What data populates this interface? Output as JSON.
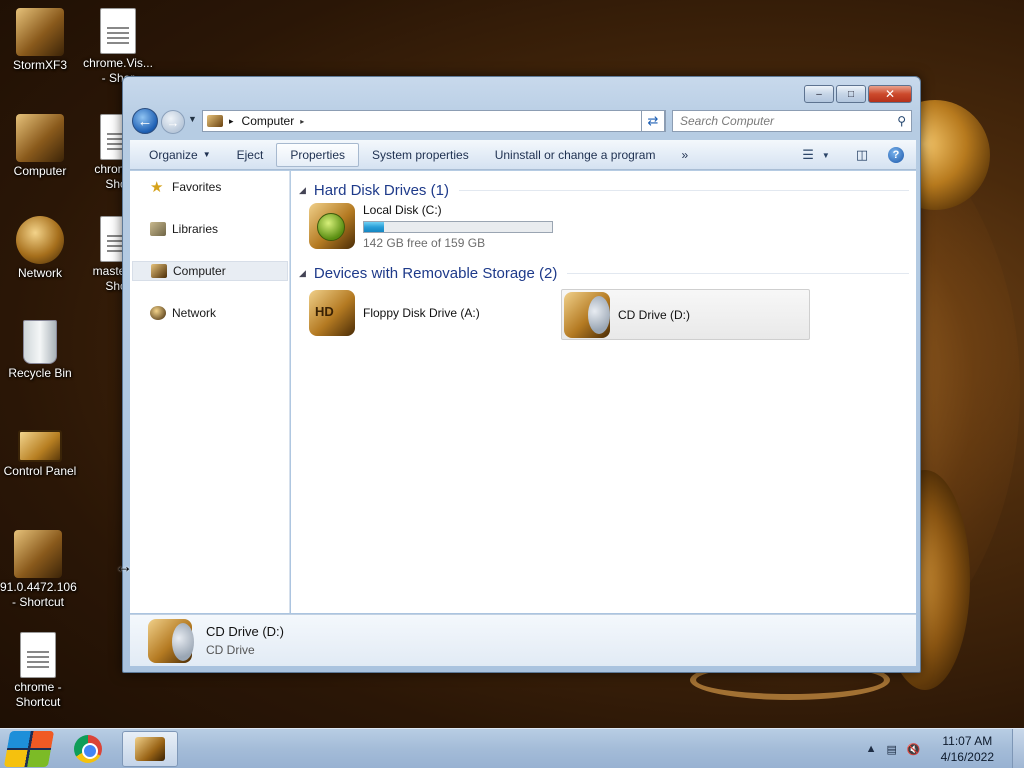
{
  "desktop": {
    "icons": [
      {
        "label": "StormXF3",
        "icon": "winrar-archive-icon"
      },
      {
        "label": "chrome.Vis... - Shor",
        "icon": "web-document-icon"
      },
      {
        "label": "Computer",
        "icon": "computer-icon"
      },
      {
        "label": "chrome - Shor",
        "icon": "shortcut-icon"
      },
      {
        "label": "Network",
        "icon": "network-icon"
      },
      {
        "label": "master_ - Shor",
        "icon": "document-icon"
      },
      {
        "label": "Recycle Bin",
        "icon": "recycle-bin-icon"
      },
      {
        "label": "Control Panel",
        "icon": "control-panel-icon"
      },
      {
        "label": "91.0.4472.106 - Shortcut",
        "icon": "archive-shortcut-icon"
      },
      {
        "label": "chrome - Shortcut",
        "icon": "chrome-shortcut-icon"
      }
    ]
  },
  "window": {
    "controls": {
      "minimize": "–",
      "maximize": "□",
      "close": "✕"
    },
    "address": {
      "crumb": "Computer",
      "separator": "▸"
    },
    "search": {
      "placeholder": "Search Computer"
    },
    "toolbar": {
      "organize": "Organize",
      "eject": "Eject",
      "properties": "Properties",
      "system_properties": "System properties",
      "uninstall": "Uninstall or change a program",
      "more": "»"
    },
    "nav": {
      "favorites": "Favorites",
      "libraries": "Libraries",
      "computer": "Computer",
      "network": "Network"
    },
    "groups": {
      "hdd_title": "Hard Disk Drives (1)",
      "removable_title": "Devices with Removable Storage (2)"
    },
    "drives": {
      "local_disk": {
        "name": "Local Disk (C:)",
        "free_text": "142 GB free of 159 GB",
        "used_fraction": 0.107
      },
      "floppy": {
        "name": "Floppy Disk Drive (A:)"
      },
      "cd": {
        "name": "CD Drive (D:)"
      }
    },
    "details": {
      "title": "CD Drive (D:)",
      "subtitle": "CD Drive"
    }
  },
  "taskbar": {
    "clock_time": "11:07 AM",
    "clock_date": "4/16/2022",
    "apps": [
      "chrome",
      "windows-explorer"
    ]
  }
}
